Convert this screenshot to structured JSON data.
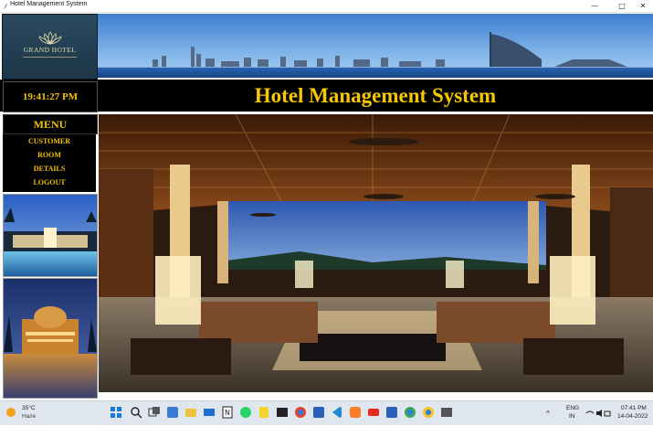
{
  "window": {
    "title": "Hotel Management System",
    "controls": {
      "minimize": "—",
      "maximize": "□",
      "close": "✕"
    }
  },
  "logo": {
    "name": "GRAND HOTEL"
  },
  "header": {
    "clock": "19:41:27 PM",
    "title": "Hotel Management System"
  },
  "menu": {
    "heading": "MENU",
    "items": [
      "CUSTOMER",
      "ROOM",
      "DETAILS",
      "LOGOUT"
    ]
  },
  "taskbar": {
    "weather": {
      "temp": "35°C",
      "condition": "Haze"
    },
    "language": {
      "lang": "ENG",
      "region": "IN"
    },
    "time": "07:41 PM",
    "date": "14-04-2022",
    "apps": [
      "windows-start",
      "search",
      "task-view",
      "widgets",
      "file-explorer",
      "mail",
      "notion",
      "whatsapp",
      "sticky-notes",
      "terminal",
      "chrome",
      "word",
      "vscode",
      "xampp",
      "youtube",
      "word-2",
      "chrome-2",
      "chrome-3",
      "app-window"
    ]
  },
  "colors": {
    "accent_gold": "#f2c400",
    "bar_black": "#000000",
    "logo_blue": "#2b4a60"
  }
}
